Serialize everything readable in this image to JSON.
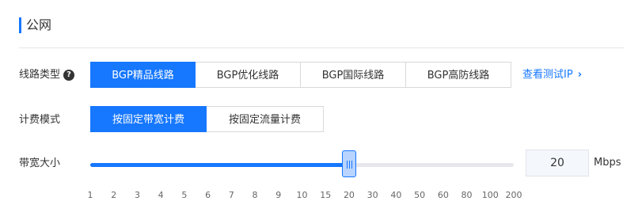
{
  "section": {
    "title": "公网"
  },
  "line_type": {
    "label": "线路类型",
    "help_icon": "question-circle-icon",
    "options": [
      "BGP精品线路",
      "BGP优化线路",
      "BGP国际线路",
      "BGP高防线路"
    ],
    "selected": "BGP精品线路",
    "link_label": "查看测试IP",
    "link_icon": "chevron-right-icon"
  },
  "billing": {
    "label": "计费模式",
    "options": [
      "按固定带宽计费",
      "按固定流量计费"
    ],
    "selected": "按固定带宽计费"
  },
  "bandwidth": {
    "label": "带宽大小",
    "value": "20",
    "unit": "Mbps",
    "ticks": [
      "1",
      "2",
      "3",
      "4",
      "5",
      "6",
      "7",
      "8",
      "9",
      "10",
      "15",
      "20",
      "30",
      "40",
      "50",
      "60",
      "80",
      "100",
      "200"
    ],
    "selected_tick_index": 11
  },
  "colors": {
    "accent": "#1677ff",
    "track": "#e8e8ec"
  }
}
